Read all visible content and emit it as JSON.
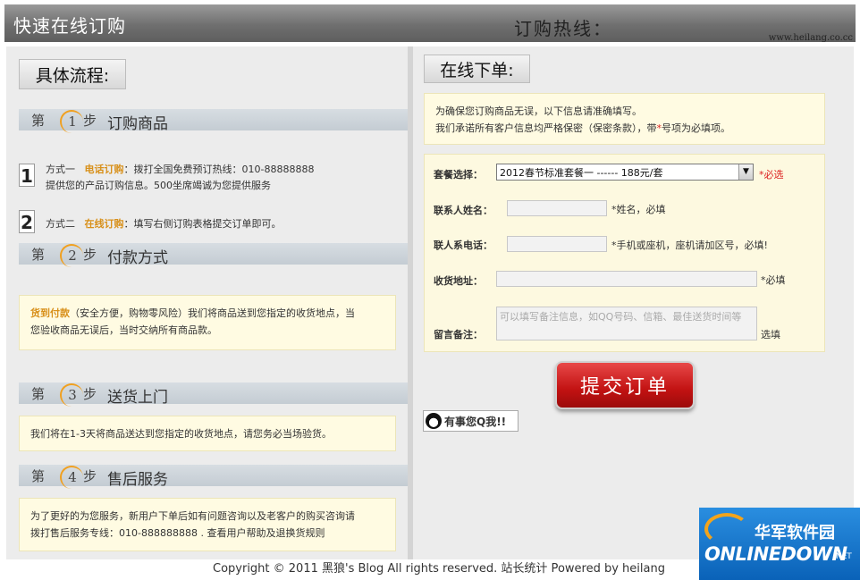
{
  "header": {
    "title": "快速在线订购",
    "hotline_label": "订购热线：",
    "site": "www.heilang.co.cc"
  },
  "left": {
    "heading": "具体流程:",
    "steps": [
      {
        "di": "第",
        "num": "1",
        "bu": "步",
        "label": "订购商品"
      },
      {
        "di": "第",
        "num": "2",
        "bu": "步",
        "label": "付款方式"
      },
      {
        "di": "第",
        "num": "3",
        "bu": "步",
        "label": "送货上门"
      },
      {
        "di": "第",
        "num": "4",
        "bu": "步",
        "label": "售后服务"
      }
    ],
    "method1": {
      "badge": "1",
      "prefix": "方式一",
      "highlight": "电话订购",
      "text": "：拨打全国免费预订热线：010-88888888",
      "line2": "提供您的产品订购信息。500坐席竭诚为您提供服务"
    },
    "method2": {
      "badge": "2",
      "prefix": "方式二",
      "highlight": "在线订购",
      "text": "：填写右侧订购表格提交订单即可。"
    },
    "payment": {
      "highlight": "货到付款",
      "line1": "（安全方便，购物零风险）我们将商品送到您指定的收货地点，当",
      "line2": "您验收商品无误后，当时交纳所有商品款。"
    },
    "delivery": "我们将在1-3天将商品送达到您指定的收货地点，请您务必当场验货。",
    "aftersale": {
      "line1": "为了更好的为您服务，新用户下单后如有问题咨询以及老客户的购买咨询请",
      "line2": "拨打售后服务专线：010-888888888 . 查看用户帮助及退换货规则"
    }
  },
  "right": {
    "heading": "在线下单:",
    "notice": {
      "line1": "为确保您订购商品无误，以下信息请准确填写。",
      "line2a": "我们承诺所有客户信息均严格保密（保密条款），带",
      "star": "*",
      "line2b": "号项为必填项。"
    },
    "form": {
      "package_label": "套餐选择：",
      "package_value": "2012春节标准套餐一 ------ 188元/套",
      "package_hint": "*必选",
      "name_label": "联系人姓名：",
      "name_hint": "*姓名，必填",
      "phone_label": "联人系电话：",
      "phone_hint": "*手机或座机，座机请加区号，必填!",
      "address_label": "收货地址：",
      "address_hint": "*必填",
      "note_label": "留言备注：",
      "note_placeholder": "可以填写备注信息，如QQ号码、信箱、最佳送货时间等",
      "note_hint": "选填"
    },
    "submit_label": "提交订单",
    "qq_label": "有事您Q我!!"
  },
  "footer": "Copyright © 2011 黑狼's Blog All rights reserved. 站长统计 Powered by heilang",
  "logo": {
    "cn": "华军软件园",
    "en": "ONLINEDOWN",
    "net": ".NET"
  }
}
